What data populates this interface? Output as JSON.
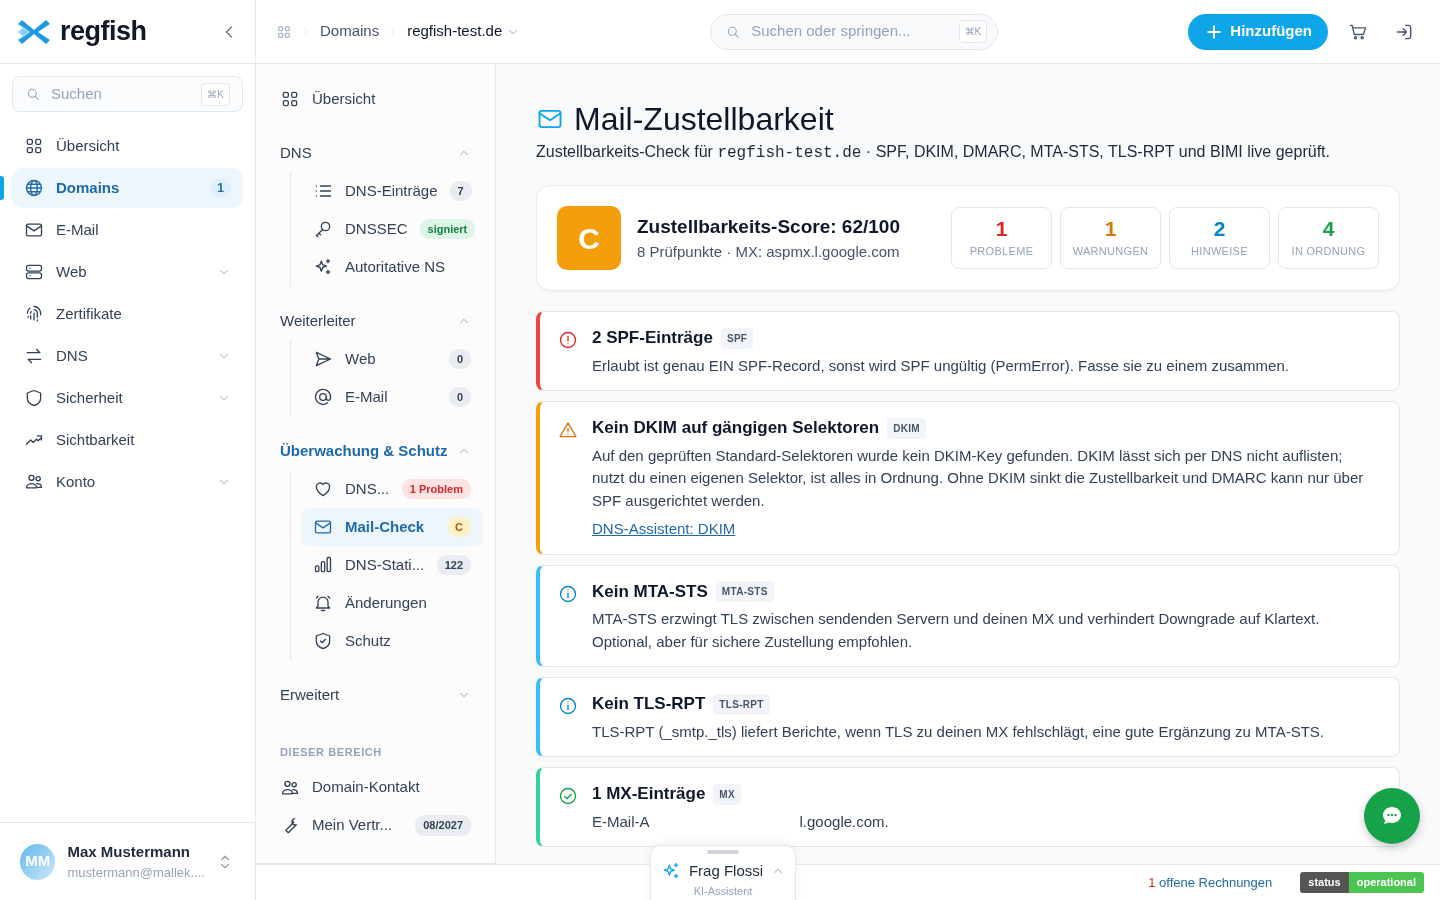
{
  "brand": {
    "name": "regfish"
  },
  "sidebar": {
    "search": {
      "placeholder": "Suchen",
      "shortcut": "⌘K"
    },
    "items": [
      {
        "label": "Übersicht",
        "selected": false,
        "has_submenu": false
      },
      {
        "label": "Domains",
        "selected": true,
        "has_submenu": false,
        "badge": "1"
      },
      {
        "label": "E-Mail",
        "selected": false,
        "has_submenu": false
      },
      {
        "label": "Web",
        "selected": false,
        "has_submenu": true
      },
      {
        "label": "Zertifikate",
        "selected": false,
        "has_submenu": false
      },
      {
        "label": "DNS",
        "selected": false,
        "has_submenu": true
      },
      {
        "label": "Sicherheit",
        "selected": false,
        "has_submenu": true
      },
      {
        "label": "Sichtbarkeit",
        "selected": false,
        "has_submenu": false
      },
      {
        "label": "Konto",
        "selected": false,
        "has_submenu": true
      }
    ],
    "user": {
      "initials": "MM",
      "name": "Max Mustermann",
      "email": "mustermann@mallek...."
    }
  },
  "breadcrumb": [
    {
      "label": "Domains",
      "current": false
    },
    {
      "label": "regfish-test.de",
      "current": true
    }
  ],
  "topbar": {
    "search": {
      "placeholder": "Suchen oder springen...",
      "shortcut": "⌘K"
    },
    "add_button": "Hinzufügen"
  },
  "subnav": {
    "overview": "Übersicht",
    "groups": [
      {
        "title": "DNS",
        "expanded": true,
        "active": false,
        "items": [
          {
            "label": "DNS-Einträge",
            "selected": false,
            "badge": "7",
            "color": "#e9edf2"
          },
          {
            "label": "DNSSEC",
            "selected": false,
            "badge": "signiert",
            "color": "#dcf5e7"
          },
          {
            "label": "Autoritative NS",
            "selected": false
          }
        ]
      },
      {
        "title": "Weiterleiter",
        "expanded": true,
        "active": false,
        "items": [
          {
            "label": "Web",
            "selected": false,
            "badge": "0",
            "color": "#e9edf2"
          },
          {
            "label": "E-Mail",
            "selected": false,
            "badge": "0",
            "color": "#e9edf2"
          }
        ]
      },
      {
        "title": "Überwachung & Schutz",
        "expanded": true,
        "active": true,
        "items": [
          {
            "label": "DNS...",
            "selected": false,
            "badge": "1 Problem",
            "color": "#fde2e2"
          },
          {
            "label": "Mail-Check",
            "selected": true,
            "badge": "C",
            "color": "#fdf1c7"
          },
          {
            "label": "DNS-Stati...",
            "selected": false,
            "badge": "122",
            "color": "#e9edf2"
          },
          {
            "label": "Änderungen",
            "selected": false
          },
          {
            "label": "Schutz",
            "selected": false
          }
        ]
      },
      {
        "title": "Erweitert",
        "expanded": false,
        "active": false
      }
    ],
    "section_label": "DIESER BEREICH",
    "section_items": [
      {
        "label": "Domain-Kontakt"
      },
      {
        "label": "Mein Vertr...",
        "badge": "08/2027"
      }
    ]
  },
  "page": {
    "title": "Mail-Zustellbarkeit",
    "subtitle_parts": [
      "Zustellbarkeits-Check für ",
      "regfish-test.de",
      " · SPF, DKIM, DMARC, MTA-STS, TLS-RPT und BIMI live geprüft."
    ]
  },
  "score": {
    "grade": "C",
    "title": "Zustellbarkeits-Score: 62/100",
    "details": "8 Prüfpunkte · MX: aspmx.l.google.com",
    "stats": [
      {
        "value": "1",
        "label": "PROBLEME",
        "kind": "error"
      },
      {
        "value": "1",
        "label": "WARNUNGEN",
        "kind": "warning"
      },
      {
        "value": "2",
        "label": "HINWEISE",
        "kind": "info"
      },
      {
        "value": "4",
        "label": "IN ORDNUNG",
        "kind": "ok"
      }
    ]
  },
  "findings": [
    {
      "kind": "error",
      "title": "2 SPF-Einträge",
      "tag": "SPF",
      "text": "Erlaubt ist genau EIN SPF-Record, sonst wird SPF ungültig (PermError). Fasse sie zu einem zusammen."
    },
    {
      "kind": "warning",
      "title": "Kein DKIM auf gängigen Selektoren",
      "tag": "DKIM",
      "text": "Auf den geprüften Standard-Selektoren wurde kein DKIM-Key gefunden. DKIM lässt sich per DNS nicht auflisten; nutzt du einen eigenen Selektor, ist alles in Ordnung. Ohne DKIM sinkt die Zustellbarkeit und DMARC kann nur über SPF ausgerichtet werden.",
      "link": "DNS-Assistent: DKIM"
    },
    {
      "kind": "info",
      "title": "Kein MTA-STS",
      "tag": "MTA-STS",
      "text": "MTA-STS erzwingt TLS zwischen sendenden Servern und deinen MX und verhindert Downgrade auf Klartext. Optional, aber für sichere Zustellung empfohlen."
    },
    {
      "kind": "info",
      "title": "Kein TLS-RPT",
      "tag": "TLS-RPT",
      "text": "TLS-RPT (_smtp._tls) liefert Berichte, wenn TLS zu deinen MX fehlschlägt, eine gute Ergänzung zu MTA-STS."
    },
    {
      "kind": "ok",
      "title": "1 MX-Einträge",
      "tag": "MX",
      "text_start": "E-Mail-A",
      "text_end": "l.google.com."
    }
  ],
  "assistant": {
    "title": "Frag Flossi",
    "subtitle": "KI-Assistent"
  },
  "footer": {
    "invoices_count": "1",
    "invoices_label": "offene Rechnungen",
    "status_label": "status",
    "status_value": "operational"
  }
}
